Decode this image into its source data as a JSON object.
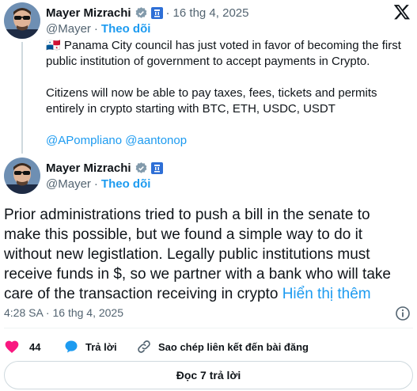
{
  "tweet1": {
    "author": "Mayer Mizrachi",
    "handle": "@Mayer",
    "sep": "·",
    "date": "16 thg 4, 2025",
    "flag": "🇵🇦",
    "line1": "Panama City council has just voted in favor of becoming the first",
    "line2": "public institution of government to accept payments in Crypto.",
    "line3": "Citizens will now be able to pay taxes, fees, tickets and permits",
    "line4": "entirely in crypto starting with BTC, ETH, USDC, USDT",
    "mentions": "@APompliano @aantonop"
  },
  "tweet2": {
    "author": "Mayer Mizrachi",
    "handle": "@Mayer",
    "sep": "·",
    "follow": "Theo dõi",
    "lines": [
      "Prior administrations tried to push a bill in the senate to",
      "make this possible, but we found a simple way to do it",
      "without new legistlation. Legally public institutions must",
      "receive funds in $, so we partner with a bank who will take"
    ],
    "last_line": "care of the transaction receiving in crypto",
    "show_more": "Hiển thị thêm",
    "timestamp": "4:28 SA · 16 thg 4, 2025"
  },
  "header": {
    "follow": "Theo dõi"
  },
  "actions": {
    "likes": "44",
    "reply": "Trả lời",
    "copy_link": "Sao chép liên kết đến bài đăng"
  },
  "read_replies": "Đọc 7 trả lời",
  "icons": {
    "x_logo": "x-logo-icon",
    "verified": "verified-badge-icon",
    "affiliate": "affiliate-badge-icon",
    "info": "info-icon",
    "heart": "heart-icon",
    "reply": "reply-bubble-icon",
    "link": "link-icon"
  },
  "colors": {
    "link": "#1d9bf0",
    "muted": "#536471",
    "heart": "#f91880",
    "badge": "#2e6fd6"
  }
}
